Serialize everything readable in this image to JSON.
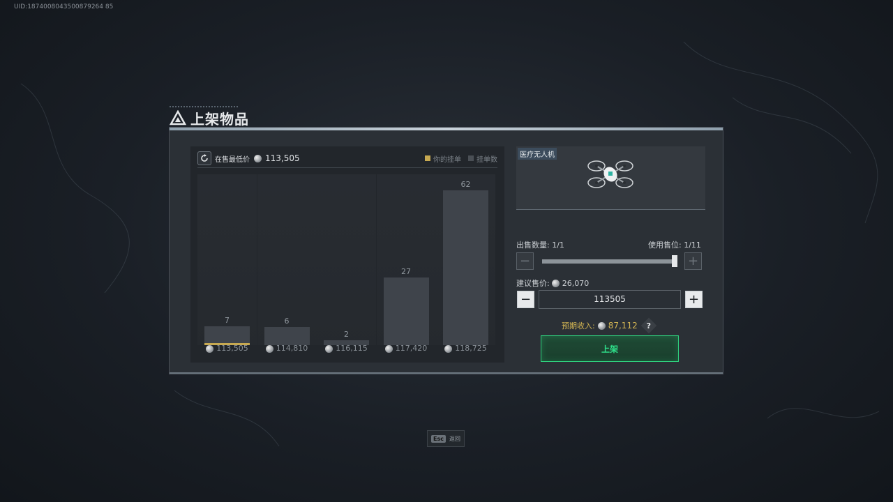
{
  "uid": "UID:1874008043500879264 85",
  "dialog": {
    "title": "上架物品"
  },
  "chart": {
    "lowest_label": "在售最低价",
    "lowest_value": "113,505",
    "legend_mine": "你的挂单",
    "legend_count": "挂单数",
    "colors": {
      "mine": "#c7a951",
      "count": "#4a4f55"
    }
  },
  "chart_data": {
    "type": "bar",
    "categories": [
      "113,505",
      "114,810",
      "116,115",
      "117,420",
      "118,725"
    ],
    "values": [
      7,
      6,
      2,
      27,
      62
    ],
    "ylim": [
      0,
      62
    ],
    "legend": [
      "你的挂单",
      "挂单数"
    ],
    "mine_index": 0
  },
  "item": {
    "name": "医疗无人机",
    "icon": "drone-icon"
  },
  "sale": {
    "qty_label": "出售数量",
    "qty_value": "1/1",
    "slot_label": "使用售位",
    "slot_value": "1/11",
    "qty_fraction": 1.0,
    "suggest_label": "建议售价",
    "suggest_value": "26,070",
    "price_input": "113505",
    "expected_label": "预期收入",
    "expected_value": "87,112",
    "help": "?",
    "list_button": "上架"
  },
  "footer": {
    "esc_key": "Esc",
    "esc_text": "返回"
  }
}
